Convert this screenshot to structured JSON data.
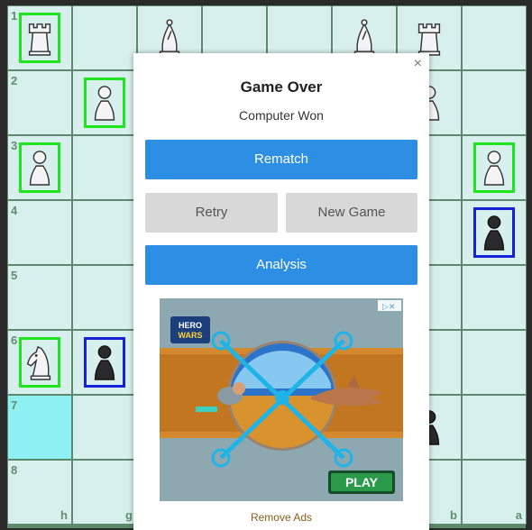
{
  "board": {
    "squares": [
      {
        "rank": "1",
        "file": null,
        "piece": "rook-white",
        "highlight": "green",
        "cell_hl": false
      },
      {
        "rank": null,
        "file": null,
        "piece": null,
        "highlight": null,
        "cell_hl": false
      },
      {
        "rank": null,
        "file": null,
        "piece": "bishop-white",
        "highlight": null,
        "cell_hl": false
      },
      {
        "rank": null,
        "file": null,
        "piece": null,
        "highlight": null,
        "cell_hl": false
      },
      {
        "rank": null,
        "file": null,
        "piece": null,
        "highlight": null,
        "cell_hl": false
      },
      {
        "rank": null,
        "file": null,
        "piece": "bishop-white",
        "highlight": null,
        "cell_hl": false
      },
      {
        "rank": null,
        "file": null,
        "piece": "rook-white",
        "highlight": null,
        "cell_hl": false
      },
      {
        "rank": null,
        "file": null,
        "piece": null,
        "highlight": null,
        "cell_hl": false
      },
      {
        "rank": "2",
        "file": null,
        "piece": null,
        "highlight": null,
        "cell_hl": false
      },
      {
        "rank": null,
        "file": null,
        "piece": "pawn-white",
        "highlight": "green",
        "cell_hl": false
      },
      {
        "rank": null,
        "file": null,
        "piece": null,
        "highlight": null,
        "cell_hl": false
      },
      {
        "rank": null,
        "file": null,
        "piece": null,
        "highlight": null,
        "cell_hl": false
      },
      {
        "rank": null,
        "file": null,
        "piece": null,
        "highlight": null,
        "cell_hl": false
      },
      {
        "rank": null,
        "file": null,
        "piece": null,
        "highlight": null,
        "cell_hl": false
      },
      {
        "rank": null,
        "file": null,
        "piece": "pawn-white",
        "highlight": null,
        "cell_hl": false
      },
      {
        "rank": null,
        "file": null,
        "piece": null,
        "highlight": null,
        "cell_hl": false
      },
      {
        "rank": "3",
        "file": null,
        "piece": "pawn-white",
        "highlight": "green",
        "cell_hl": false
      },
      {
        "rank": null,
        "file": null,
        "piece": null,
        "highlight": null,
        "cell_hl": false
      },
      {
        "rank": null,
        "file": null,
        "piece": null,
        "highlight": null,
        "cell_hl": false
      },
      {
        "rank": null,
        "file": null,
        "piece": null,
        "highlight": null,
        "cell_hl": false
      },
      {
        "rank": null,
        "file": null,
        "piece": null,
        "highlight": null,
        "cell_hl": false
      },
      {
        "rank": null,
        "file": null,
        "piece": null,
        "highlight": null,
        "cell_hl": false
      },
      {
        "rank": null,
        "file": null,
        "piece": null,
        "highlight": null,
        "cell_hl": false
      },
      {
        "rank": null,
        "file": null,
        "piece": "pawn-white",
        "highlight": "green",
        "cell_hl": false
      },
      {
        "rank": "4",
        "file": null,
        "piece": null,
        "highlight": null,
        "cell_hl": false
      },
      {
        "rank": null,
        "file": null,
        "piece": null,
        "highlight": null,
        "cell_hl": false
      },
      {
        "rank": null,
        "file": null,
        "piece": null,
        "highlight": null,
        "cell_hl": false
      },
      {
        "rank": null,
        "file": null,
        "piece": null,
        "highlight": null,
        "cell_hl": false
      },
      {
        "rank": null,
        "file": null,
        "piece": null,
        "highlight": null,
        "cell_hl": false
      },
      {
        "rank": null,
        "file": null,
        "piece": null,
        "highlight": null,
        "cell_hl": false
      },
      {
        "rank": null,
        "file": null,
        "piece": null,
        "highlight": null,
        "cell_hl": false
      },
      {
        "rank": null,
        "file": null,
        "piece": "pawn-black",
        "highlight": "blue",
        "cell_hl": false
      },
      {
        "rank": "5",
        "file": null,
        "piece": null,
        "highlight": null,
        "cell_hl": false
      },
      {
        "rank": null,
        "file": null,
        "piece": null,
        "highlight": null,
        "cell_hl": false
      },
      {
        "rank": null,
        "file": null,
        "piece": null,
        "highlight": null,
        "cell_hl": false
      },
      {
        "rank": null,
        "file": null,
        "piece": null,
        "highlight": null,
        "cell_hl": false
      },
      {
        "rank": null,
        "file": null,
        "piece": null,
        "highlight": null,
        "cell_hl": false
      },
      {
        "rank": null,
        "file": null,
        "piece": null,
        "highlight": null,
        "cell_hl": false
      },
      {
        "rank": null,
        "file": null,
        "piece": null,
        "highlight": null,
        "cell_hl": false
      },
      {
        "rank": null,
        "file": null,
        "piece": null,
        "highlight": null,
        "cell_hl": false
      },
      {
        "rank": "6",
        "file": null,
        "piece": "knight-white",
        "highlight": "green",
        "cell_hl": false
      },
      {
        "rank": null,
        "file": null,
        "piece": "pawn-black",
        "highlight": "blue",
        "cell_hl": false
      },
      {
        "rank": null,
        "file": null,
        "piece": null,
        "highlight": null,
        "cell_hl": false
      },
      {
        "rank": null,
        "file": null,
        "piece": null,
        "highlight": null,
        "cell_hl": false
      },
      {
        "rank": null,
        "file": null,
        "piece": null,
        "highlight": null,
        "cell_hl": false
      },
      {
        "rank": null,
        "file": null,
        "piece": null,
        "highlight": null,
        "cell_hl": false
      },
      {
        "rank": null,
        "file": null,
        "piece": null,
        "highlight": null,
        "cell_hl": false
      },
      {
        "rank": null,
        "file": null,
        "piece": null,
        "highlight": null,
        "cell_hl": false
      },
      {
        "rank": "7",
        "file": null,
        "piece": null,
        "highlight": null,
        "cell_hl": true
      },
      {
        "rank": null,
        "file": null,
        "piece": null,
        "highlight": null,
        "cell_hl": false
      },
      {
        "rank": null,
        "file": null,
        "piece": null,
        "highlight": null,
        "cell_hl": false
      },
      {
        "rank": null,
        "file": null,
        "piece": null,
        "highlight": null,
        "cell_hl": false
      },
      {
        "rank": null,
        "file": null,
        "piece": null,
        "highlight": null,
        "cell_hl": false
      },
      {
        "rank": null,
        "file": null,
        "piece": null,
        "highlight": null,
        "cell_hl": false
      },
      {
        "rank": null,
        "file": null,
        "piece": "pawn-black",
        "highlight": null,
        "cell_hl": false
      },
      {
        "rank": null,
        "file": null,
        "piece": null,
        "highlight": null,
        "cell_hl": false
      },
      {
        "rank": "8",
        "file": "h",
        "piece": null,
        "highlight": null,
        "cell_hl": false
      },
      {
        "rank": null,
        "file": "g",
        "piece": null,
        "highlight": null,
        "cell_hl": false
      },
      {
        "rank": null,
        "file": null,
        "piece": null,
        "highlight": null,
        "cell_hl": false
      },
      {
        "rank": null,
        "file": null,
        "piece": null,
        "highlight": null,
        "cell_hl": false
      },
      {
        "rank": null,
        "file": null,
        "piece": null,
        "highlight": null,
        "cell_hl": false
      },
      {
        "rank": null,
        "file": null,
        "piece": null,
        "highlight": null,
        "cell_hl": false
      },
      {
        "rank": null,
        "file": "b",
        "piece": null,
        "highlight": null,
        "cell_hl": false
      },
      {
        "rank": null,
        "file": "a",
        "piece": null,
        "highlight": null,
        "cell_hl": false
      }
    ]
  },
  "modal": {
    "close": "×",
    "title": "Game Over",
    "subtitle": "Computer Won",
    "rematch": "Rematch",
    "retry": "Retry",
    "new_game": "New Game",
    "analysis": "Analysis",
    "remove_ads": "Remove Ads"
  },
  "ad": {
    "brand": "HERO WARS",
    "cta": "PLAY"
  },
  "colors": {
    "primary_button": "#2d8fe3",
    "secondary_button": "#d8d8d8",
    "highlight_green": "#1ee51e",
    "highlight_blue": "#1521d8",
    "square": "#d7efed",
    "square_highlight": "#8ff0f4"
  }
}
